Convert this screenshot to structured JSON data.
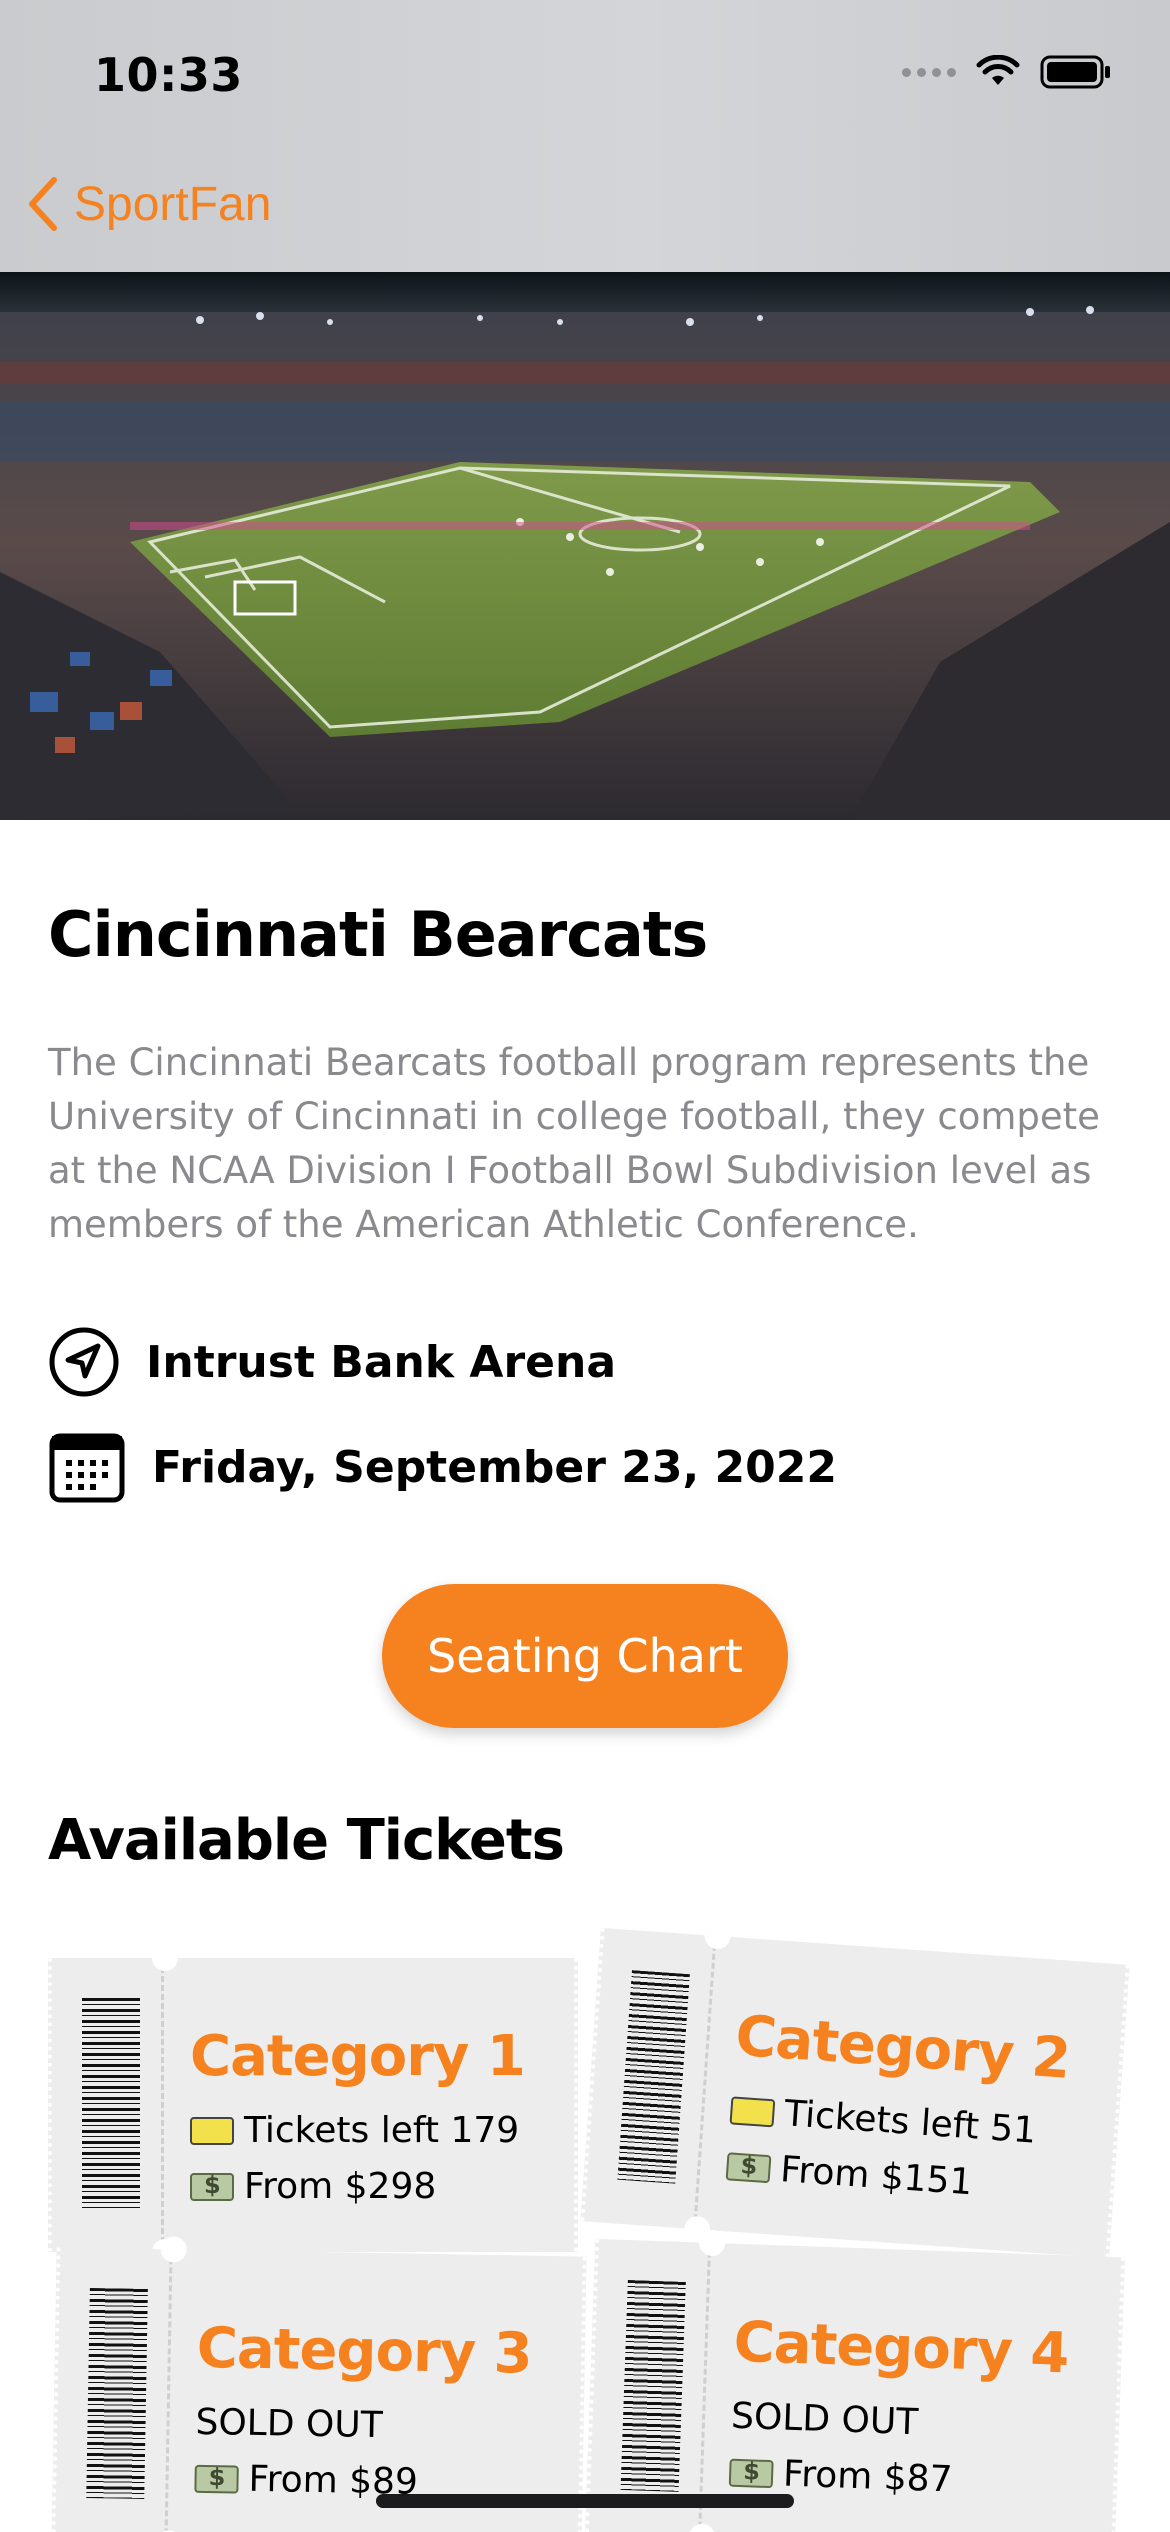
{
  "status_bar": {
    "time": "10:33"
  },
  "nav": {
    "back_label": "SportFan"
  },
  "event": {
    "title": "Cincinnati Bearcats",
    "description": "The Cincinnati Bearcats football program represents the University of Cincinnati in college football, they compete at the NCAA Division I Football Bowl Subdivision level as members of the American Athletic Conference.",
    "venue": "Intrust Bank Arena",
    "date": "Friday, September 23, 2022"
  },
  "actions": {
    "seating_chart_label": "Seating Chart"
  },
  "tickets_section": {
    "title": "Available Tickets",
    "items": [
      {
        "category": "Category 1",
        "availability": "Tickets left 179",
        "price": "From $298"
      },
      {
        "category": "Category 2",
        "availability": "Tickets left 51",
        "price": "From $151"
      },
      {
        "category": "Category 3",
        "availability": "SOLD OUT",
        "price": "From $89"
      },
      {
        "category": "Category 4",
        "availability": "SOLD OUT",
        "price": "From $87"
      }
    ]
  },
  "colors": {
    "accent": "#f5821f",
    "description_text": "#8a8a8e",
    "ticket_bg": "#ededed"
  },
  "icons": {
    "back": "chevron-left-icon",
    "venue": "location-arrow-icon",
    "date": "calendar-icon",
    "ticket": "ticket-icon",
    "money": "money-icon"
  }
}
